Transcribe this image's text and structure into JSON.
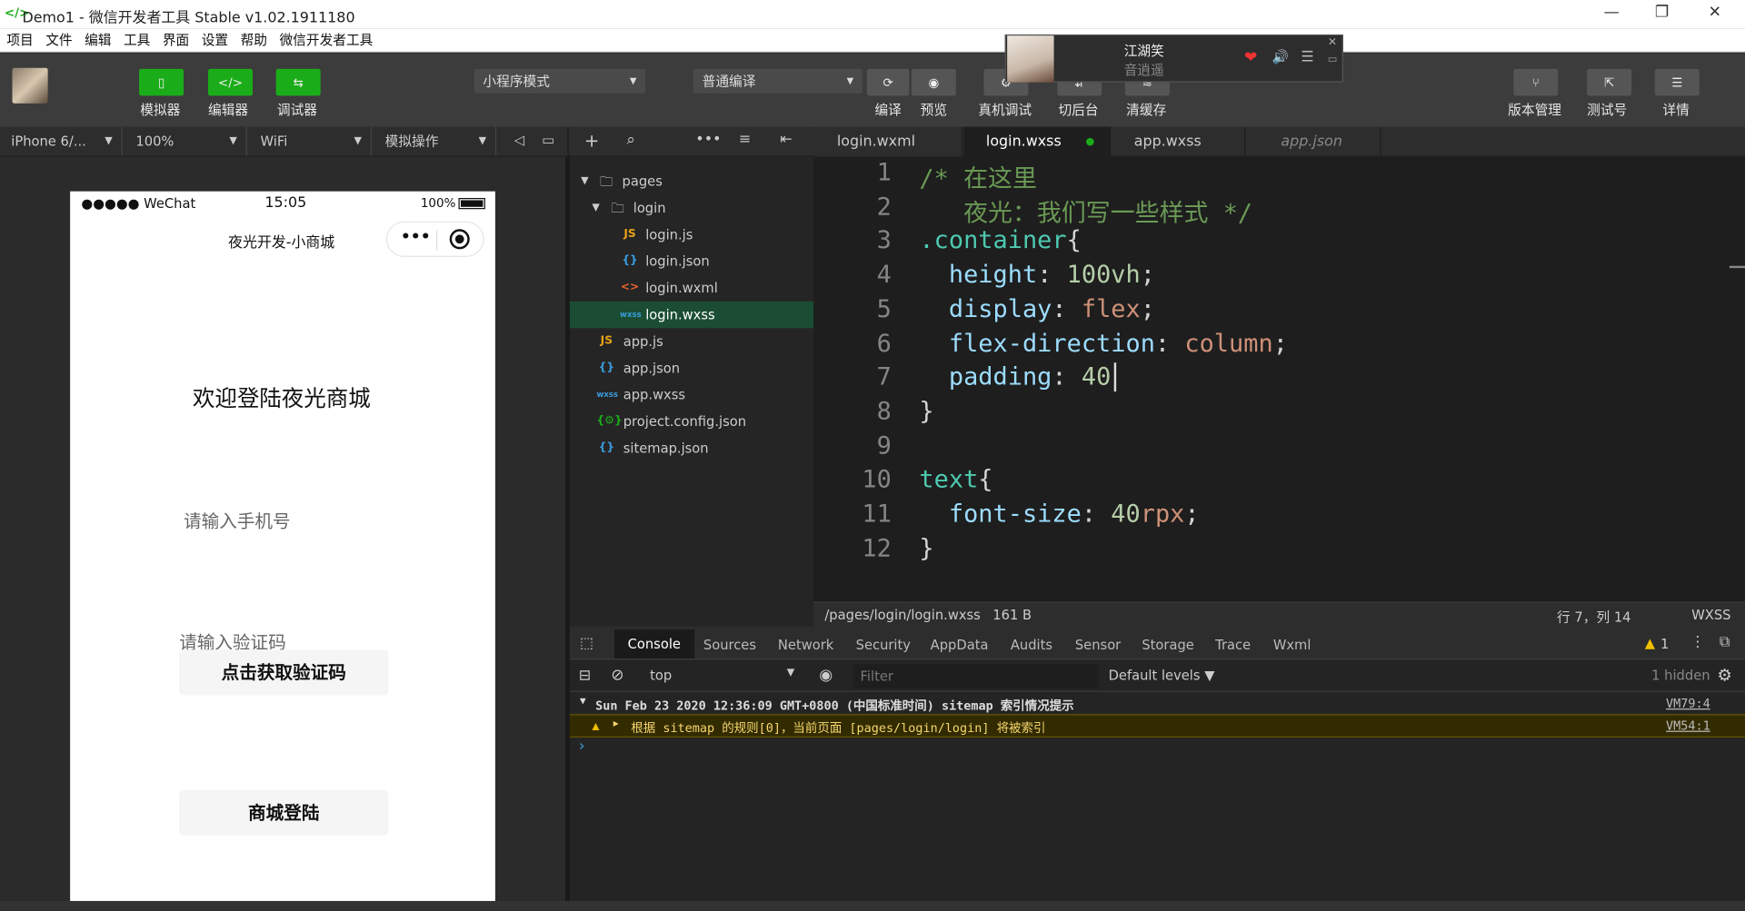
{
  "window": {
    "title": "Demo1 - 微信开发者工具 Stable v1.02.1911180",
    "logo": "</>"
  },
  "menu": [
    "项目",
    "文件",
    "编辑",
    "工具",
    "界面",
    "设置",
    "帮助",
    "微信开发者工具"
  ],
  "toolbar": {
    "left": [
      {
        "label": "模拟器",
        "icon": "phone-icon"
      },
      {
        "label": "编辑器",
        "icon": "code-icon"
      },
      {
        "label": "调试器",
        "icon": "debug-icon"
      }
    ],
    "mode_select": "小程序模式",
    "compile_select": "普通编译",
    "mid": [
      {
        "label": "编译",
        "icon": "refresh-icon"
      },
      {
        "label": "预览",
        "icon": "eye-icon"
      },
      {
        "label": "真机调试",
        "icon": "debug-device-icon"
      },
      {
        "label": "切后台",
        "icon": "background-icon"
      },
      {
        "label": "清缓存",
        "icon": "layers-icon"
      }
    ],
    "right": [
      {
        "label": "版本管理",
        "icon": "branch-icon"
      },
      {
        "label": "测试号",
        "icon": "share-icon"
      },
      {
        "label": "详情",
        "icon": "menu-icon"
      }
    ]
  },
  "music": {
    "title": "江湖笑",
    "subtitle": "音逍遥",
    "heart": "❤",
    "speaker": "🔊",
    "list": "☰",
    "close": "✕",
    "min": "▭"
  },
  "subbar": {
    "device": "iPhone 6/...",
    "zoom": "100%",
    "network": "WiFi",
    "op": "模拟操作"
  },
  "editor_tabs": [
    {
      "label": "login.wxml"
    },
    {
      "label": "login.wxss",
      "active": true,
      "modified": true
    },
    {
      "label": "app.wxss"
    },
    {
      "label": "app.json",
      "italic": true
    }
  ],
  "phone": {
    "status": {
      "carrier": "●●●●● WeChat",
      "time": "15:05",
      "battery": "100%"
    },
    "nav_title": "夜光开发-小商城",
    "nav_dots": "•••",
    "welcome": "欢迎登陆夜光商城",
    "phone_placeholder": "请输入手机号",
    "code_placeholder": "请输入验证码",
    "get_code_btn": "点击获取验证码",
    "login_btn": "商城登陆"
  },
  "tree": [
    {
      "label": "pages",
      "type": "folder",
      "depth": 0
    },
    {
      "label": "login",
      "type": "folder",
      "depth": 1
    },
    {
      "label": "login.js",
      "type": "js",
      "depth": 2
    },
    {
      "label": "login.json",
      "type": "json",
      "depth": 2
    },
    {
      "label": "login.wxml",
      "type": "wxml",
      "depth": 2
    },
    {
      "label": "login.wxss",
      "type": "wxss",
      "depth": 2,
      "selected": true
    },
    {
      "label": "app.js",
      "type": "js",
      "depth": 1
    },
    {
      "label": "app.json",
      "type": "json",
      "depth": 1
    },
    {
      "label": "app.wxss",
      "type": "wxss",
      "depth": 1
    },
    {
      "label": "project.config.json",
      "type": "cfg",
      "depth": 1
    },
    {
      "label": "sitemap.json",
      "type": "json",
      "depth": 1
    }
  ],
  "code_lines": [
    [
      {
        "t": "/* 在这里",
        "c": "#6a9955"
      }
    ],
    [
      {
        "t": "   夜光：我们写一些样式 */",
        "c": "#6a9955"
      }
    ],
    [
      {
        "t": ".container",
        "c": "#4ec9b0"
      },
      {
        "t": "{",
        "c": "#d4d4d4"
      }
    ],
    [
      {
        "t": "  height",
        "c": "#9cdcfe"
      },
      {
        "t": ": ",
        "c": "#d4d4d4"
      },
      {
        "t": "100vh",
        "c": "#b5cea8"
      },
      {
        "t": ";",
        "c": "#d4d4d4"
      }
    ],
    [
      {
        "t": "  display",
        "c": "#9cdcfe"
      },
      {
        "t": ": ",
        "c": "#d4d4d4"
      },
      {
        "t": "flex",
        "c": "#ce9178"
      },
      {
        "t": ";",
        "c": "#d4d4d4"
      }
    ],
    [
      {
        "t": "  flex-direction",
        "c": "#9cdcfe"
      },
      {
        "t": ": ",
        "c": "#d4d4d4"
      },
      {
        "t": "column",
        "c": "#ce9178"
      },
      {
        "t": ";",
        "c": "#d4d4d4"
      }
    ],
    [
      {
        "t": "  padding",
        "c": "#9cdcfe"
      },
      {
        "t": ": ",
        "c": "#d4d4d4"
      },
      {
        "t": "40",
        "c": "#b5cea8"
      }
    ],
    [
      {
        "t": "}",
        "c": "#d4d4d4"
      }
    ],
    [],
    [
      {
        "t": "text",
        "c": "#4ec9b0"
      },
      {
        "t": "{",
        "c": "#d4d4d4"
      }
    ],
    [
      {
        "t": "  font-size",
        "c": "#9cdcfe"
      },
      {
        "t": ": ",
        "c": "#d4d4d4"
      },
      {
        "t": "40",
        "c": "#b5cea8"
      },
      {
        "t": "rpx",
        "c": "#ce9178"
      },
      {
        "t": ";",
        "c": "#d4d4d4"
      }
    ],
    [
      {
        "t": "}",
        "c": "#d4d4d4"
      }
    ]
  ],
  "status": {
    "path": "/pages/login/login.wxss",
    "size": "161 B",
    "pos": "行 7，列 14",
    "lang": "WXSS"
  },
  "console": {
    "tabs": [
      "Console",
      "Sources",
      "Network",
      "Security",
      "AppData",
      "Audits",
      "Sensor",
      "Storage",
      "Trace",
      "Wxml"
    ],
    "warn_count": "1",
    "context": "top",
    "filter_placeholder": "Filter",
    "levels": "Default levels ▼",
    "hidden": "1 hidden",
    "group": "Sun Feb 23 2020 12:36:09 GMT+0800 (中国标准时间) sitemap 索引情况提示",
    "group_src": "VM79:4",
    "warn": "根据 sitemap 的规则[0]，当前页面 [pages/login/login] 将被索引",
    "warn_src": "VM54:1",
    "prompt": "›"
  },
  "colors": {
    "accent": "#1aad19",
    "bg": "#1e1e1e"
  }
}
